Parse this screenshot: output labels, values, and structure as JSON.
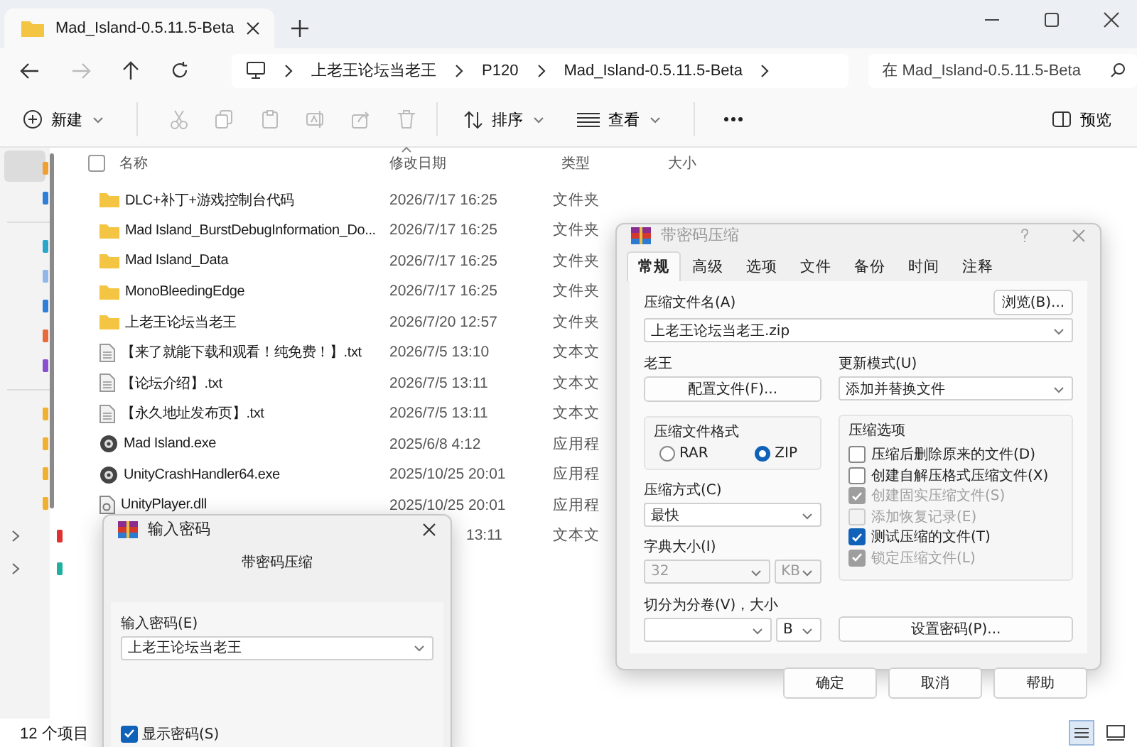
{
  "explorer": {
    "tab": {
      "title": "Mad_Island-0.5.11.5-Beta"
    },
    "breadcrumb": [
      "上老王论坛当老王",
      "P120",
      "Mad_Island-0.5.11.5-Beta"
    ],
    "search": {
      "placeholder": "在 Mad_Island-0.5.11.5-Beta"
    },
    "toolbar": {
      "new": "新建",
      "sort": "排序",
      "view": "查看",
      "preview": "预览"
    },
    "columns": [
      "名称",
      "修改日期",
      "类型",
      "大小"
    ],
    "select_all": {
      "checked": false
    },
    "rows": [
      {
        "kind": "folder",
        "name": "DLC+补丁+游戏控制台代码",
        "date": "2026/7/17 16:25",
        "type": "文件夹"
      },
      {
        "kind": "folder",
        "name": "Mad Island_BurstDebugInformation_Do...",
        "date": "2026/7/17 16:25",
        "type": "文件夹"
      },
      {
        "kind": "folder",
        "name": "Mad Island_Data",
        "date": "2026/7/17 16:25",
        "type": "文件夹"
      },
      {
        "kind": "folder",
        "name": "MonoBleedingEdge",
        "date": "2026/7/17 16:25",
        "type": "文件夹"
      },
      {
        "kind": "folder",
        "name": "上老王论坛当老王",
        "date": "2026/7/20 12:57",
        "type": "文件夹"
      },
      {
        "kind": "text",
        "name": "【来了就能下载和观看！纯免费！】.txt",
        "date": "2026/7/5 13:10",
        "type": "文本文"
      },
      {
        "kind": "text",
        "name": "【论坛介绍】.txt",
        "date": "2026/7/5 13:11",
        "type": "文本文"
      },
      {
        "kind": "text",
        "name": "【永久地址发布页】.txt",
        "date": "2026/7/5 13:11",
        "type": "文本文"
      },
      {
        "kind": "exe",
        "name": "Mad Island.exe",
        "date": "2025/6/8 4:12",
        "type": "应用程"
      },
      {
        "kind": "exe",
        "name": "UnityCrashHandler64.exe",
        "date": "2025/10/25 20:01",
        "type": "应用程"
      },
      {
        "kind": "dll",
        "name": "UnityPlayer.dll",
        "date": "2025/10/25 20:01",
        "type": "应用程"
      },
      {
        "kind": "hidden",
        "date": "13:11",
        "type": "文本文"
      }
    ],
    "status": "12 个项目"
  },
  "archive_dialog": {
    "title": "带密码压缩",
    "tabs": [
      {
        "label": "常规",
        "selected": true
      },
      {
        "label": "高级",
        "selected": false
      },
      {
        "label": "选项",
        "selected": false
      },
      {
        "label": "文件",
        "selected": false
      },
      {
        "label": "备份",
        "selected": false
      },
      {
        "label": "时间",
        "selected": false
      },
      {
        "label": "注释",
        "selected": false
      }
    ],
    "archive_name": {
      "label": "压缩文件名(A)",
      "value": "上老王论坛当老王.zip",
      "browse": "浏览(B)..."
    },
    "profile": {
      "label": "老王",
      "button": "配置文件(F)..."
    },
    "update_mode": {
      "label": "更新模式(U)",
      "value": "添加并替换文件"
    },
    "format": {
      "label": "压缩文件格式",
      "options": [
        {
          "label": "RAR",
          "selected": false
        },
        {
          "label": "ZIP",
          "selected": true
        }
      ]
    },
    "options": {
      "label": "压缩选项",
      "items": [
        {
          "label": "压缩后删除原来的文件(D)",
          "checked": false,
          "disabled": false
        },
        {
          "label": "创建自解压格式压缩文件(X)",
          "checked": false,
          "disabled": false
        },
        {
          "label": "创建固实压缩文件(S)",
          "checked": true,
          "disabled": true
        },
        {
          "label": "添加恢复记录(E)",
          "checked": false,
          "disabled": true
        },
        {
          "label": "测试压缩的文件(T)",
          "checked": true,
          "disabled": false
        },
        {
          "label": "锁定压缩文件(L)",
          "checked": true,
          "disabled": true
        }
      ]
    },
    "method": {
      "label": "压缩方式(C)",
      "value": "最快"
    },
    "dictionary": {
      "label": "字典大小(I)",
      "value": "32",
      "unit": "KB",
      "disabled": true
    },
    "split": {
      "label": "切分为分卷(V)，大小",
      "unit": "B"
    },
    "set_password": "设置密码(P)...",
    "buttons": [
      "确定",
      "取消",
      "帮助"
    ]
  },
  "password_dialog": {
    "title": "输入密码",
    "heading": "带密码压缩",
    "label": "输入密码(E)",
    "value": "上老王论坛当老王",
    "show_password": {
      "label": "显示密码(S)",
      "checked": true
    }
  }
}
